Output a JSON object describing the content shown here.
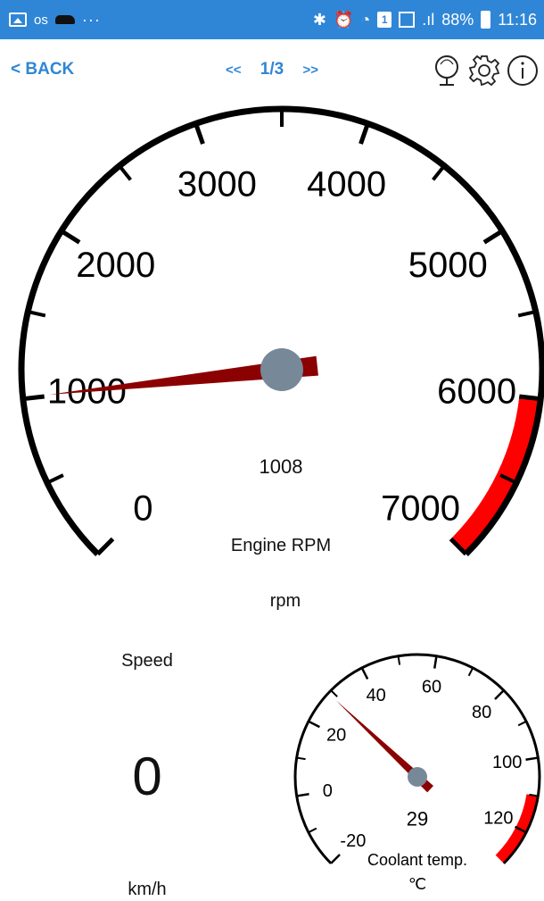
{
  "status_bar": {
    "carrier": "os",
    "more": "···",
    "battery_percent": "88%",
    "time": "11:16",
    "sim_label": "1"
  },
  "toolbar": {
    "back_label": "< BACK",
    "prev_label": "<<",
    "page_indicator": "1/3",
    "next_label": ">>",
    "icons": [
      "map-pin-icon",
      "gear-icon",
      "info-icon"
    ]
  },
  "rpm_gauge": {
    "title": "Engine RPM",
    "unit": "rpm",
    "value": 1008,
    "value_label": "1008",
    "min": 0,
    "max": 7000,
    "tick_labels": [
      "0",
      "1000",
      "2000",
      "3000",
      "4000",
      "5000",
      "6000",
      "7000"
    ],
    "redline_start": 6000,
    "needle_color": "#8b0000",
    "redline_color": "#ff0000",
    "hub_color": "#778899"
  },
  "speed": {
    "title": "Speed",
    "value": "0",
    "unit": "km/h"
  },
  "coolant_gauge": {
    "title": "Coolant temp.",
    "unit": "℃",
    "value": 29,
    "value_label": "29",
    "min": -20,
    "max": 130,
    "tick_labels": [
      "-20",
      "0",
      "20",
      "40",
      "60",
      "80",
      "100",
      "120"
    ],
    "redline_start": 110,
    "needle_color": "#8b0000",
    "redline_color": "#ff0000",
    "hub_color": "#778899"
  }
}
